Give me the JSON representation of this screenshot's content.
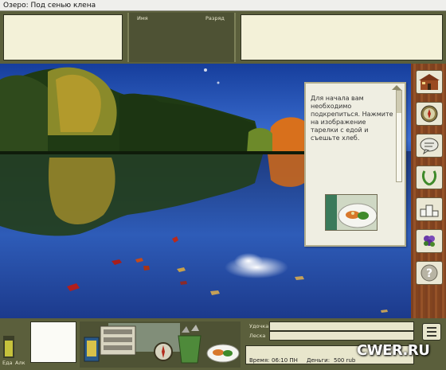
{
  "window": {
    "title": "Озеро: Под сенью клена"
  },
  "top_panel": {
    "col_name": "Имя",
    "col_rank": "Разряд"
  },
  "tip": {
    "text": "Для начала вам необходимо подкрепиться. Нажмите на изображение тарелки с едой и съешьте хлеб.",
    "image_icon": "plate-of-food-icon"
  },
  "sidebar": {
    "buttons": [
      {
        "icon": "house-icon"
      },
      {
        "icon": "compass-icon"
      },
      {
        "icon": "chat-bubble-icon"
      },
      {
        "icon": "laurel-wreath-icon"
      },
      {
        "icon": "podium-icon"
      },
      {
        "icon": "grapes-icon"
      },
      {
        "icon": "help-icon"
      }
    ]
  },
  "bottom_panel": {
    "food_label": "Еда",
    "alcohol_label": "Алк",
    "food_level_fraction": 0.85,
    "rod_label": "Удочка",
    "line_label": "Леска",
    "time_label": "Время:",
    "time_value": "06:10 ПН",
    "money_label": "Деньги:",
    "money_value": "500 rub",
    "items": [
      {
        "icon": "tackle-box-icon"
      },
      {
        "icon": "bait-box-icon"
      },
      {
        "icon": "compass-item-icon"
      },
      {
        "icon": "bucket-of-fish-icon"
      },
      {
        "icon": "plate-of-food-icon"
      }
    ]
  },
  "watermark": "CWER.RU",
  "colors": {
    "panel_olive": "#5b5f3c",
    "panel_cream": "#f3f1d8",
    "sidebar_wood": "#8a4a22",
    "sky_blue": "#2c5ab4"
  }
}
